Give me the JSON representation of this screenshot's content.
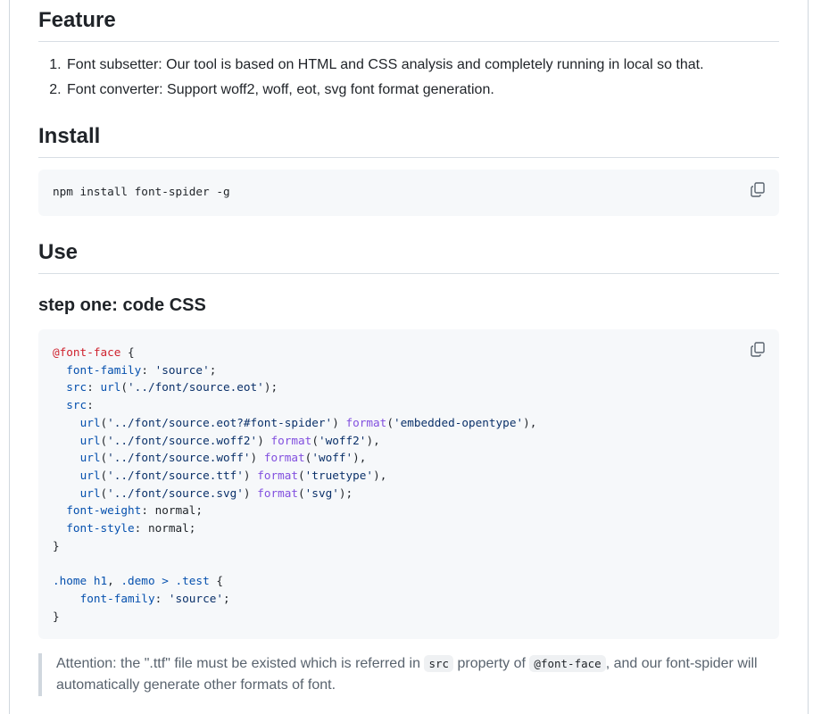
{
  "sections": {
    "feature": {
      "heading": "Feature",
      "items": [
        "Font subsetter: Our tool is based on HTML and CSS analysis and completely running in local so that.",
        "Font converter: Support woff2, woff, eot, svg font format generation."
      ]
    },
    "install": {
      "heading": "Install",
      "command": "npm install font-spider -g"
    },
    "use": {
      "heading": "Use",
      "step_one": "step one: code CSS"
    },
    "attention": {
      "text_before": "Attention: the \".ttf\" file must be existed which is referred in",
      "code_src": "src",
      "text_mid": "property of",
      "code_fontface": "@font-face",
      "text_after": ", and our font-spider will automatically generate other formats of font."
    }
  },
  "icons": {
    "copy": "copy-icon"
  },
  "colors": {
    "at_rule": "#cf222e",
    "property": "#0550ae",
    "string": "#0a3069",
    "function_name": "#8250df",
    "code_background": "#f6f8fa"
  },
  "css_code": {
    "lines": [
      [
        {
          "t": "at",
          "v": "@font-face"
        },
        {
          "t": "",
          "v": " {"
        }
      ],
      [
        {
          "t": "",
          "v": "  "
        },
        {
          "t": "prop",
          "v": "font-family"
        },
        {
          "t": "",
          "v": ": "
        },
        {
          "t": "str",
          "v": "'source'"
        },
        {
          "t": "",
          "v": ";"
        }
      ],
      [
        {
          "t": "",
          "v": "  "
        },
        {
          "t": "prop",
          "v": "src"
        },
        {
          "t": "",
          "v": ": "
        },
        {
          "t": "fn",
          "v": "url"
        },
        {
          "t": "",
          "v": "("
        },
        {
          "t": "str",
          "v": "'../font/source.eot'"
        },
        {
          "t": "",
          "v": ");"
        }
      ],
      [
        {
          "t": "",
          "v": "  "
        },
        {
          "t": "prop",
          "v": "src"
        },
        {
          "t": "",
          "v": ":"
        }
      ],
      [
        {
          "t": "",
          "v": "    "
        },
        {
          "t": "fn",
          "v": "url"
        },
        {
          "t": "",
          "v": "("
        },
        {
          "t": "str",
          "v": "'../font/source.eot?#font-spider'"
        },
        {
          "t": "",
          "v": ") "
        },
        {
          "t": "kw",
          "v": "format"
        },
        {
          "t": "",
          "v": "("
        },
        {
          "t": "str",
          "v": "'embedded-opentype'"
        },
        {
          "t": "",
          "v": "),"
        }
      ],
      [
        {
          "t": "",
          "v": "    "
        },
        {
          "t": "fn",
          "v": "url"
        },
        {
          "t": "",
          "v": "("
        },
        {
          "t": "str",
          "v": "'../font/source.woff2'"
        },
        {
          "t": "",
          "v": ") "
        },
        {
          "t": "kw",
          "v": "format"
        },
        {
          "t": "",
          "v": "("
        },
        {
          "t": "str",
          "v": "'woff2'"
        },
        {
          "t": "",
          "v": "),"
        }
      ],
      [
        {
          "t": "",
          "v": "    "
        },
        {
          "t": "fn",
          "v": "url"
        },
        {
          "t": "",
          "v": "("
        },
        {
          "t": "str",
          "v": "'../font/source.woff'"
        },
        {
          "t": "",
          "v": ") "
        },
        {
          "t": "kw",
          "v": "format"
        },
        {
          "t": "",
          "v": "("
        },
        {
          "t": "str",
          "v": "'woff'"
        },
        {
          "t": "",
          "v": "),"
        }
      ],
      [
        {
          "t": "",
          "v": "    "
        },
        {
          "t": "fn",
          "v": "url"
        },
        {
          "t": "",
          "v": "("
        },
        {
          "t": "str",
          "v": "'../font/source.ttf'"
        },
        {
          "t": "",
          "v": ") "
        },
        {
          "t": "kw",
          "v": "format"
        },
        {
          "t": "",
          "v": "("
        },
        {
          "t": "str",
          "v": "'truetype'"
        },
        {
          "t": "",
          "v": "),"
        }
      ],
      [
        {
          "t": "",
          "v": "    "
        },
        {
          "t": "fn",
          "v": "url"
        },
        {
          "t": "",
          "v": "("
        },
        {
          "t": "str",
          "v": "'../font/source.svg'"
        },
        {
          "t": "",
          "v": ") "
        },
        {
          "t": "kw",
          "v": "format"
        },
        {
          "t": "",
          "v": "("
        },
        {
          "t": "str",
          "v": "'svg'"
        },
        {
          "t": "",
          "v": ");"
        }
      ],
      [
        {
          "t": "",
          "v": "  "
        },
        {
          "t": "prop",
          "v": "font-weight"
        },
        {
          "t": "",
          "v": ": normal;"
        }
      ],
      [
        {
          "t": "",
          "v": "  "
        },
        {
          "t": "prop",
          "v": "font-style"
        },
        {
          "t": "",
          "v": ": normal;"
        }
      ],
      [
        {
          "t": "",
          "v": "}"
        }
      ],
      [
        {
          "t": "",
          "v": ""
        }
      ],
      [
        {
          "t": "sel",
          "v": ".home h1"
        },
        {
          "t": "",
          "v": ", "
        },
        {
          "t": "sel",
          "v": ".demo"
        },
        {
          "t": "",
          "v": " "
        },
        {
          "t": "sel",
          "v": ">"
        },
        {
          "t": "",
          "v": " "
        },
        {
          "t": "sel",
          "v": ".test"
        },
        {
          "t": "",
          "v": " {"
        }
      ],
      [
        {
          "t": "",
          "v": "    "
        },
        {
          "t": "prop",
          "v": "font-family"
        },
        {
          "t": "",
          "v": ": "
        },
        {
          "t": "str",
          "v": "'source'"
        },
        {
          "t": "",
          "v": ";"
        }
      ],
      [
        {
          "t": "",
          "v": "}"
        }
      ]
    ]
  }
}
